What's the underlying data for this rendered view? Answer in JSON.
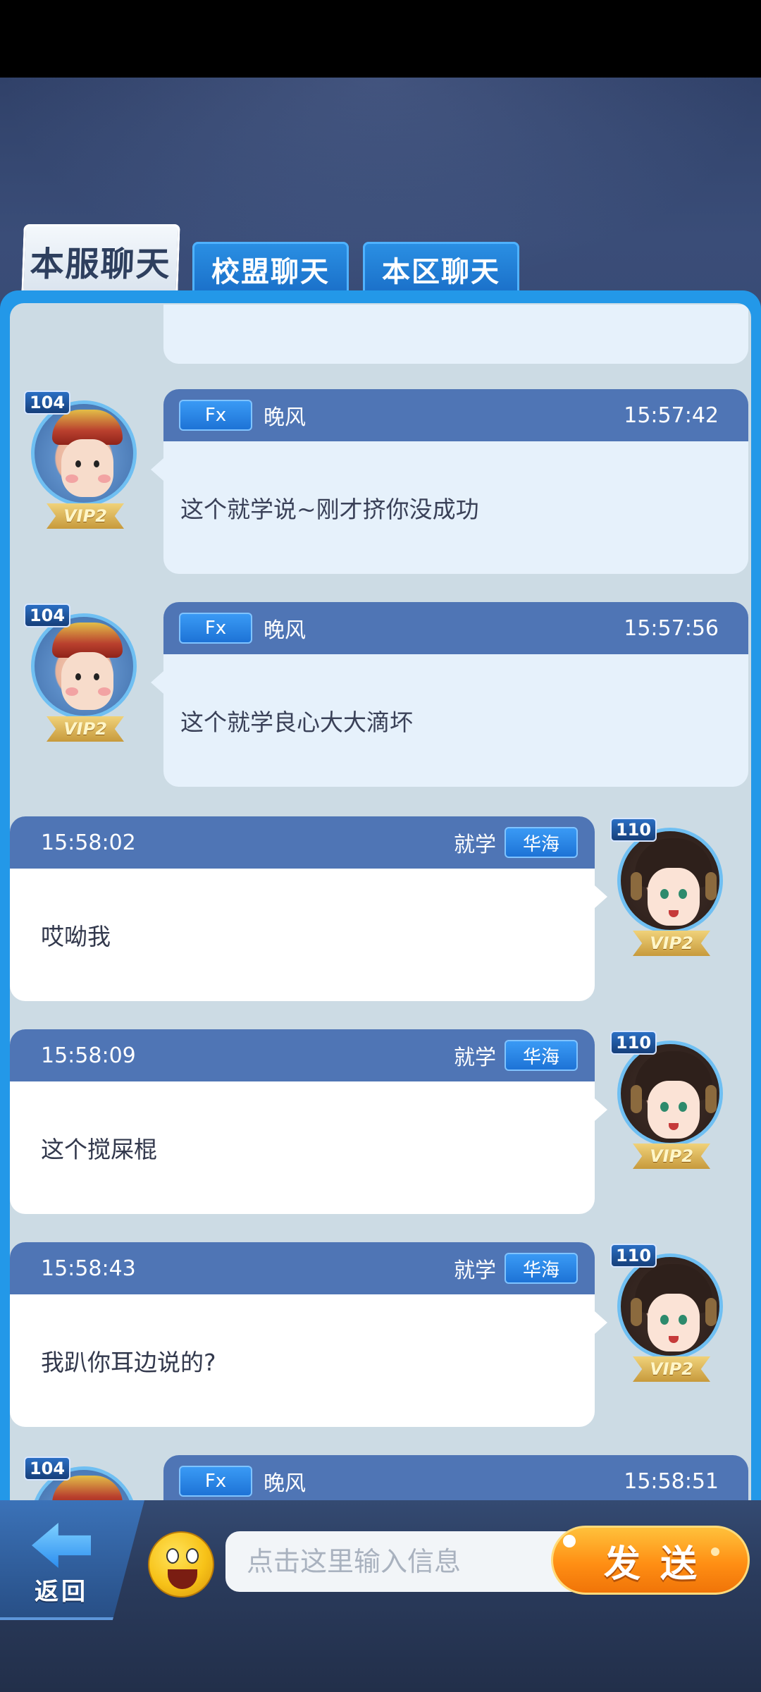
{
  "tabs": [
    "本服聊天",
    "校盟聊天",
    "本区聊天"
  ],
  "messages": [
    {
      "side": "left",
      "level": "104",
      "vip": "VIP2",
      "tag": "Fx",
      "name": "晚风",
      "time": "15:57:42",
      "text": "这个就学说~刚才挤你没成功"
    },
    {
      "side": "left",
      "level": "104",
      "vip": "VIP2",
      "tag": "Fx",
      "name": "晚风",
      "time": "15:57:56",
      "text": "这个就学良心大大滴坏"
    },
    {
      "side": "right",
      "level": "110",
      "vip": "VIP2",
      "tag": "华海",
      "name": "就学",
      "time": "15:58:02",
      "text": "哎呦我"
    },
    {
      "side": "right",
      "level": "110",
      "vip": "VIP2",
      "tag": "华海",
      "name": "就学",
      "time": "15:58:09",
      "text": "这个搅屎棍"
    },
    {
      "side": "right",
      "level": "110",
      "vip": "VIP2",
      "tag": "华海",
      "name": "就学",
      "time": "15:58:43",
      "text": "我趴你耳边说的?"
    },
    {
      "side": "left",
      "level": "104",
      "vip": "VIP2",
      "tag": "Fx",
      "name": "晚风",
      "time": "15:58:51",
      "text": ""
    }
  ],
  "bottom": {
    "back_label": "返回",
    "input_placeholder": "点击这里输入信息",
    "send_label": "发送"
  },
  "colors": {
    "header_bar": "#4f75b5",
    "panel_border": "#2398e8",
    "send_orange": "#ff8f14"
  }
}
